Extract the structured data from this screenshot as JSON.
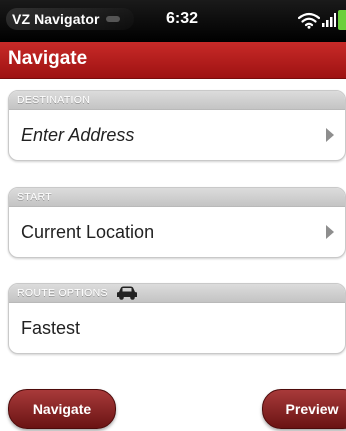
{
  "status_bar": {
    "app_name": "VZ Navigator",
    "time": "6:32",
    "battery_color": "#6ccf3c"
  },
  "header": {
    "title": "Navigate",
    "accent_color": "#b11d1c"
  },
  "destination": {
    "section_label": "DESTINATION",
    "value": "Enter Address",
    "icon": "chevron-right-icon"
  },
  "start": {
    "section_label": "START",
    "value": "Current Location",
    "icon": "chevron-right-icon"
  },
  "route_options": {
    "section_label": "ROUTE OPTIONS",
    "section_icon": "car-icon",
    "value": "Fastest"
  },
  "buttons": {
    "navigate_label": "Navigate",
    "preview_label": "Preview"
  }
}
